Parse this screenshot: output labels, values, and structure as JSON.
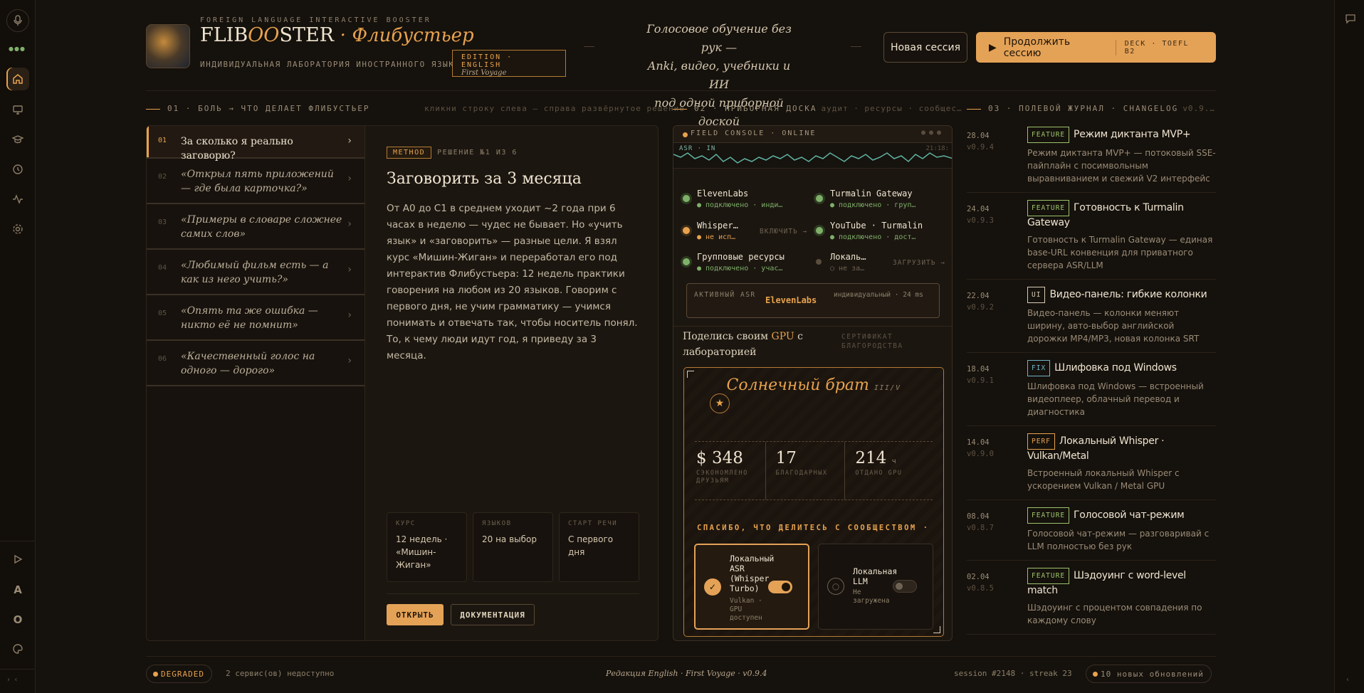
{
  "rail": {
    "icons": [
      "mic-icon",
      "home-icon",
      "monitor-icon",
      "graduation-icon",
      "history-icon",
      "activity-icon",
      "gear-icon"
    ],
    "letters": [
      "A",
      "O"
    ]
  },
  "header": {
    "brand_top": "FOREIGN LANGUAGE INTERACTIVE BOOSTER",
    "brand_a": "FLIB",
    "brand_b": "OO",
    "brand_c": "STER",
    "brand_sep": "·",
    "brand_ru": "Флибустьер",
    "brand_sub": "ИНДИВИДУАЛЬНАЯ ЛАБОРАТОРИЯ ИНОСТРАННОГО ЯЗЫКА",
    "edition": "EDITION · ENGLISH",
    "edition_sub": "First Voyage",
    "tagline1": "Голосовое обучение без рук —",
    "tagline2": "Anki, видео, учебники и ИИ",
    "tagline3": "под одной приборной доской",
    "new_session": "Новая сессия",
    "continue_session": "Продолжить сессию",
    "deck": "DECK · TOEFL B2"
  },
  "sections": {
    "s1": "01 · БОЛЬ → ЧТО ДЕЛАЕТ ФЛИБУСТЬЕР",
    "s1_hint": "кликни строку слева — справа развёрнутое решение",
    "s2": "02 · ПРИБОРНАЯ ДОСКА",
    "s2_hint": "аудит · ресурсы · сообщес…",
    "s3": "03 · ПОЛЕВОЙ ЖУРНАЛ · CHANGELOG",
    "s3_hint": "v0.9.…"
  },
  "pains": [
    {
      "n": "01",
      "t": "За сколько я реально заговорю?"
    },
    {
      "n": "02",
      "t": "«Открыл пять приложений — где была карточка?»"
    },
    {
      "n": "03",
      "t": "«Примеры в словаре сложнее самих слов»"
    },
    {
      "n": "04",
      "t": "«Любимый фильм есть — а как из него учить?»"
    },
    {
      "n": "05",
      "t": "«Опять та же ошибка — никто её не помнит»"
    },
    {
      "n": "06",
      "t": "«Качественный голос на одного — дорого»"
    }
  ],
  "detail": {
    "badge": "METHOD",
    "sol": "РЕШЕНИЕ №1 ИЗ 6",
    "title": "Заговорить за 3 месяца",
    "body": "От A0 до C1 в среднем уходит ~2 года при 6 часах в неделю — чудес не бывает. Но «учить язык» и «заговорить» — разные цели. Я взял курс «Мишин-Жиган» и переработал его под интерактив Флибустьера: 12 недель практики говорения на любом из 20 языков. Говорим с первого дня, не учим грамматику — учимся понимать и отвечать так, чтобы носитель понял. То, к чему люди идут год, я приведу за 3 месяца.",
    "stats": [
      {
        "k": "КУРС",
        "v": "12 недель · «Мишин-Жиган»"
      },
      {
        "k": "ЯЗЫКОВ",
        "v": "20 на выбор"
      },
      {
        "k": "СТАРТ РЕЧИ",
        "v": "С первого дня"
      }
    ],
    "open": "ОТКРЫТЬ",
    "docs": "ДОКУМЕНТАЦИЯ"
  },
  "console": {
    "head": "FIELD CONSOLE · ONLINE",
    "asr_label": "ASR · IN",
    "time": "21:18:",
    "services": [
      {
        "name": "ElevenLabs",
        "status": "● подключено · инди…",
        "state": "ok"
      },
      {
        "name": "Turmalin Gateway",
        "status": "● подключено · груп…",
        "state": "ok"
      },
      {
        "name": "Whisper…",
        "status": "● не исп…",
        "state": "warn",
        "action": "ВКЛЮЧИТЬ →"
      },
      {
        "name": "YouTube · Turmalin",
        "status": "● подключено · дост…",
        "state": "ok"
      },
      {
        "name": "Групповые ресурсы",
        "status": "● подключено · учас…",
        "state": "ok"
      },
      {
        "name": "Локаль…",
        "status": "○ не за…",
        "state": "off",
        "action": "ЗАГРУЗИТЬ →"
      }
    ],
    "active_asr_label": "АКТИВНЫЙ ASR",
    "active_asr_value": "ElevenLabs",
    "active_asr_meta": "индивидуальный · 24 ms",
    "share_a": "Поделись своим ",
    "share_gpu": "GPU",
    "share_b": " с лабораторией",
    "cert": "СЕРТИФИКАТ БЛАГОРОДСТВА",
    "card_title": "Солнечный брат",
    "card_rank": "III/V",
    "metrics": [
      {
        "v": "$ 348",
        "u": "",
        "k": "СЭКОНОМЛЕНО ДРУЗЬЯМ"
      },
      {
        "v": "17",
        "u": "",
        "k": "БЛАГОДАРНЫХ"
      },
      {
        "v": "214",
        "u": "ч",
        "k": "ОТДАНО GPU"
      }
    ],
    "thanks": "СПАСИБО, ЧТО ДЕЛИТЕСЬ С СООБЩЕСТВОМ ·",
    "opt1_name": "Локальный ASR (Whisper Turbo)",
    "opt1_sub": "Vulkan · GPU доступен",
    "opt2_name": "Локальная LLM",
    "opt2_sub": "Не загружена"
  },
  "changelog": [
    {
      "date": "28.04",
      "ver": "v0.9.4",
      "tag": "FEATURE",
      "tagColor": "#9cc36b",
      "title": "Режим диктанта MVP+",
      "desc": "Режим диктанта MVP+ — потоковый SSE-пайплайн с посимвольным выравниванием и свежий V2 интерфейс"
    },
    {
      "date": "24.04",
      "ver": "v0.9.3",
      "tag": "FEATURE",
      "tagColor": "#9cc36b",
      "title": "Готовность к Turmalin Gateway",
      "desc": "Готовность к Turmalin Gateway — единая base-URL конвенция для приватного сервера ASR/LLM"
    },
    {
      "date": "22.04",
      "ver": "v0.9.2",
      "tag": "UI",
      "tagColor": "#d9cdb8",
      "title": "Видео-панель: гибкие колонки",
      "desc": "Видео-панель — колонки меняют ширину, авто-выбор английской дорожки MP4/MP3, новая колонка SRT"
    },
    {
      "date": "18.04",
      "ver": "v0.9.1",
      "tag": "FIX",
      "tagColor": "#6fb5c9",
      "title": "Шлифовка под Windows",
      "desc": "Шлифовка под Windows — встроенный видеоплеер, облачный перевод и диагностика"
    },
    {
      "date": "14.04",
      "ver": "v0.9.0",
      "tag": "PERF",
      "tagColor": "#e8a24e",
      "title": "Локальный Whisper · Vulkan/Metal",
      "desc": "Встроенный локальный Whisper с ускорением Vulkan / Metal GPU"
    },
    {
      "date": "08.04",
      "ver": "v0.8.7",
      "tag": "FEATURE",
      "tagColor": "#9cc36b",
      "title": "Голосовой чат-режим",
      "desc": "Голосовой чат-режим — разговаривай с LLM полностью без рук"
    },
    {
      "date": "02.04",
      "ver": "v0.8.5",
      "tag": "FEATURE",
      "tagColor": "#9cc36b",
      "title": "Шэдоуинг с word-level match",
      "desc": "Шэдоуинг с процентом совпадения по каждому слову"
    }
  ],
  "footer": {
    "status": "DEGRADED",
    "down": "2 сервис(ов) недоступно",
    "edition": "Редакция English · First Voyage · v0.9.4",
    "session": "session #2148 · streak 23",
    "updates": "10 новых обновлений"
  }
}
